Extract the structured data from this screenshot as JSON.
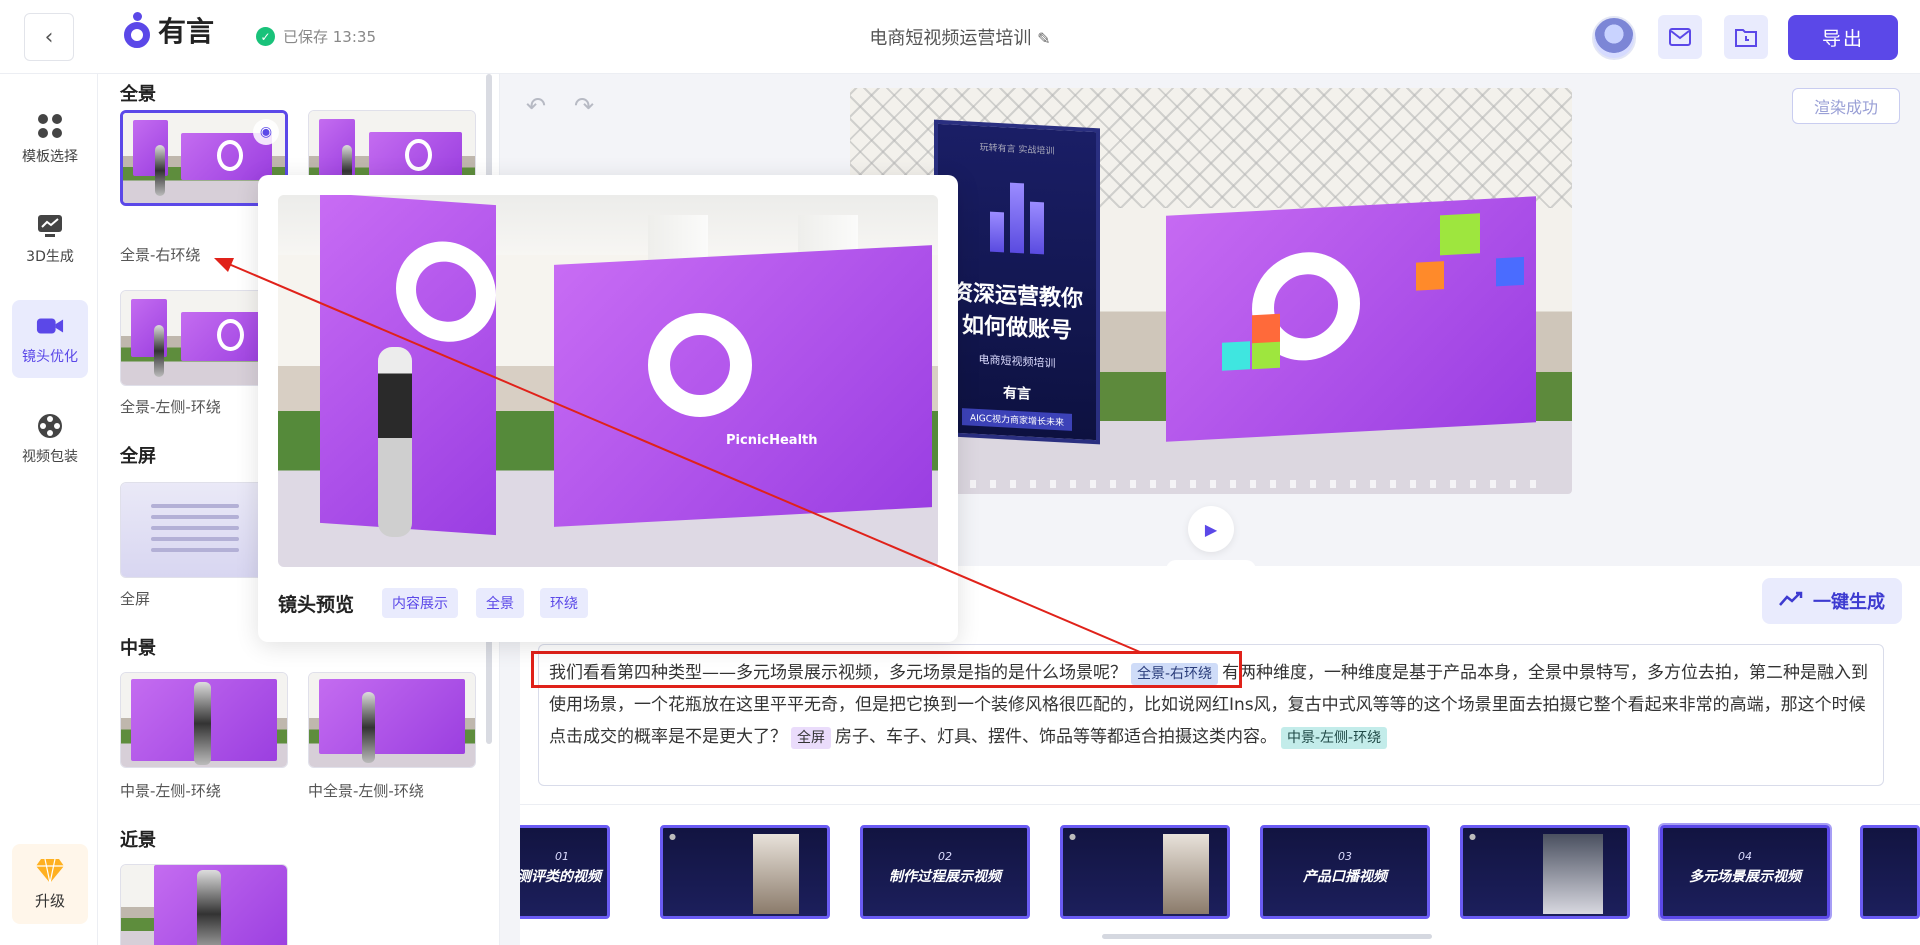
{
  "header": {
    "back_icon": "chevron-left-icon",
    "logo_text": "有言",
    "save_status": "已保存 13:35",
    "doc_title": "电商短视频运营培训",
    "export_label": "导出"
  },
  "nav": {
    "items": [
      {
        "label": "模板选择",
        "icon": "grid-icon"
      },
      {
        "label": "3D生成",
        "icon": "chart-monitor-icon"
      },
      {
        "label": "镜头优化",
        "icon": "camera-icon"
      },
      {
        "label": "视频包装",
        "icon": "film-reel-icon"
      }
    ],
    "upgrade_label": "升级"
  },
  "panel": {
    "sections": [
      {
        "title": "全景",
        "captions": [
          "全景-右环绕",
          "全景-左侧-环绕"
        ]
      },
      {
        "title": "全屏",
        "captions": [
          "全屏"
        ]
      },
      {
        "title": "中景",
        "captions": [
          "中景-左侧-环绕",
          "中全景-左侧-环绕"
        ]
      },
      {
        "title": "近景",
        "captions": []
      }
    ]
  },
  "editor": {
    "render_status": "渲染成功",
    "generate_label": "一键生成",
    "poster": {
      "top": "玩转有言 实战培训",
      "headline1": "资深运营教你",
      "headline2": "如何做账号",
      "sub": "电商短视频培训",
      "logo": "有言",
      "footer": "AIGC视力商家增长未来"
    },
    "script": {
      "seg1": "我们看看第四种类型——多元场景展示视频，多元场景是指的是什么场景呢？",
      "tag1": "全景-右环绕",
      "seg2": "有两种维度，一种维度是基于产品本身，全景中景特写，多方位去拍，第二种是融入到使用场景，一个花瓶放在这里平平无奇，但是把它换到一个装修风格很匹配的，比如说网红Ins风，复古中式风等等的这个场景里面去拍摄它整个看起来非常的高端，那这个时候点击成交的概率是不是更大了？",
      "tag2": "全屏",
      "seg3": "房子、车子、灯具、摆件、饰品等等都适合拍摄这类内容。",
      "tag3": "中景-左侧-环绕"
    }
  },
  "filmstrip": [
    {
      "num": "01",
      "label": "测评类的视频",
      "photo": false
    },
    {
      "num": "",
      "label": "",
      "photo": true
    },
    {
      "num": "02",
      "label": "制作过程展示视频",
      "photo": false
    },
    {
      "num": "",
      "label": "",
      "photo": true
    },
    {
      "num": "03",
      "label": "产品口播视频",
      "photo": false
    },
    {
      "num": "",
      "label": "",
      "photo": true
    },
    {
      "num": "04",
      "label": "多元场景展示视频",
      "photo": false
    },
    {
      "num": "",
      "label": "",
      "photo": false
    }
  ],
  "popover": {
    "title": "镜头预览",
    "tags": [
      "内容展示",
      "全景",
      "环绕"
    ],
    "brand": "PicnicHealth"
  },
  "colors": {
    "accent": "#5b48e8",
    "accent_light": "#e9ebfd",
    "annotation_red": "#e0221a"
  }
}
